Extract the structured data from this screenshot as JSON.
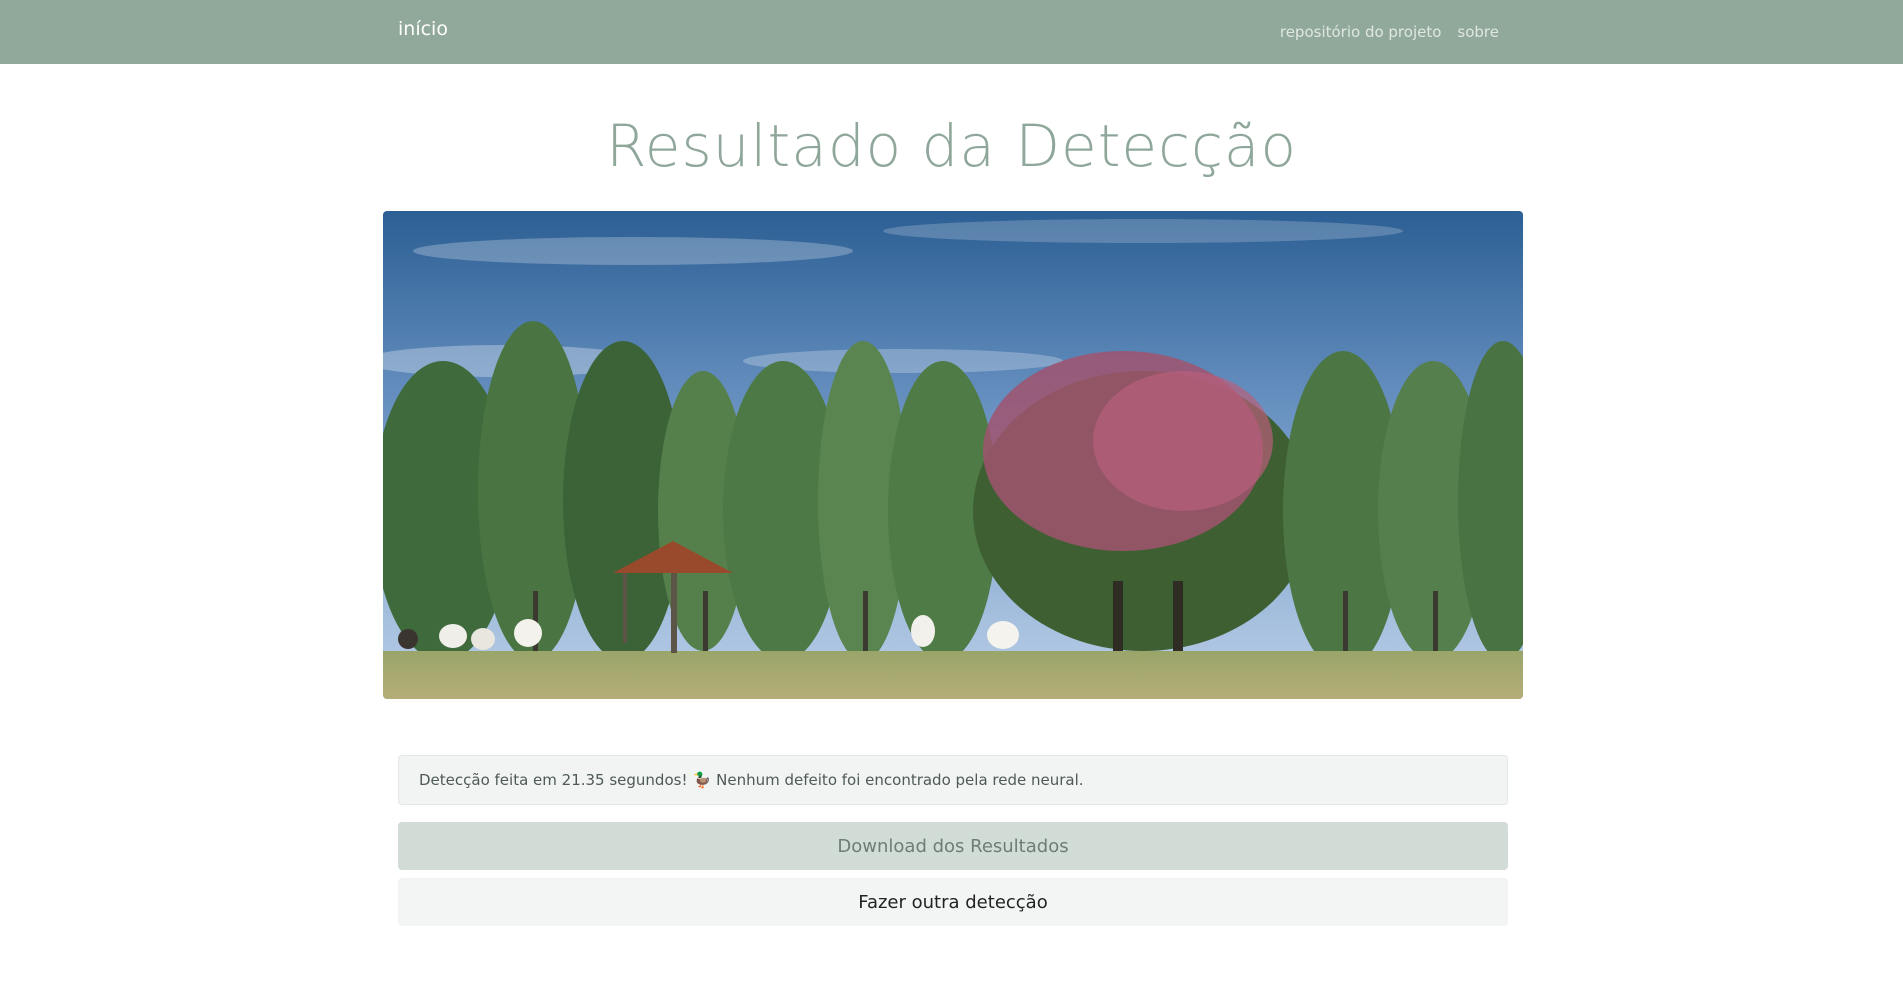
{
  "navbar": {
    "brand": "início",
    "links": [
      "repositório do projeto",
      "sobre"
    ]
  },
  "main": {
    "title": "Resultado da Detecção",
    "alert": {
      "prefix": "Detecção feita em 21.35 segundos!",
      "emoji": "🦆",
      "suffix": "Nenhum defeito foi encontrado pela rede neural."
    },
    "download_label": "Download dos Resultados",
    "again_label": "Fazer outra detecção"
  },
  "colors": {
    "navbar_bg": "#91a99a",
    "title": "#8fa79a",
    "download_bg": "#d1dcd7"
  }
}
